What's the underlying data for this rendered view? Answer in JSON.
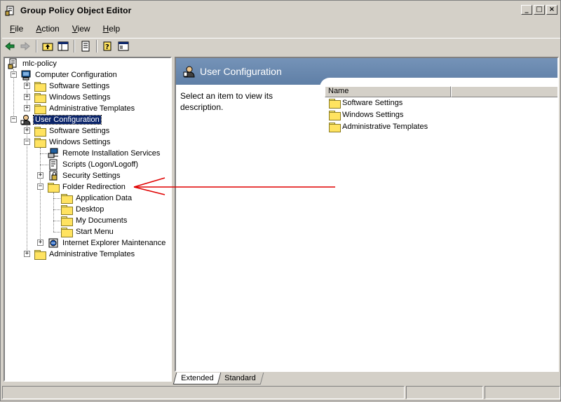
{
  "window": {
    "title": "Group Policy Object Editor"
  },
  "menu": [
    {
      "accel": "F",
      "rest": "ile"
    },
    {
      "accel": "A",
      "rest": "ction"
    },
    {
      "accel": "V",
      "rest": "iew"
    },
    {
      "accel": "H",
      "rest": "elp"
    }
  ],
  "toolbar": [
    "back-icon",
    "forward-icon",
    "up-folder-icon",
    "show-hide-tree-icon",
    "export-list-icon",
    "help-icon",
    "console-icon"
  ],
  "tree": {
    "root": "mlc-policy",
    "computer_config": "Computer Configuration",
    "cc_software": "Software Settings",
    "cc_windows": "Windows Settings",
    "cc_admin": "Administrative Templates",
    "user_config": "User Configuration",
    "uc_software": "Software Settings",
    "uc_windows": "Windows Settings",
    "ris": "Remote Installation Services",
    "scripts": "Scripts (Logon/Logoff)",
    "security": "Security Settings",
    "folder_redirection": "Folder Redirection",
    "app_data": "Application Data",
    "desktop": "Desktop",
    "my_documents": "My Documents",
    "start_menu": "Start Menu",
    "ie_maintenance": "Internet Explorer Maintenance",
    "uc_admin": "Administrative Templates"
  },
  "details": {
    "header": "User Configuration",
    "description": "Select an item to view its description.",
    "column_name": "Name",
    "items": [
      "Software Settings",
      "Windows Settings",
      "Administrative Templates"
    ]
  },
  "tabs": {
    "extended": "Extended",
    "standard": "Standard"
  },
  "colors": {
    "selection": "#0a246a",
    "header": "#6b8ab0",
    "annotation_arrow": "#e00000"
  }
}
